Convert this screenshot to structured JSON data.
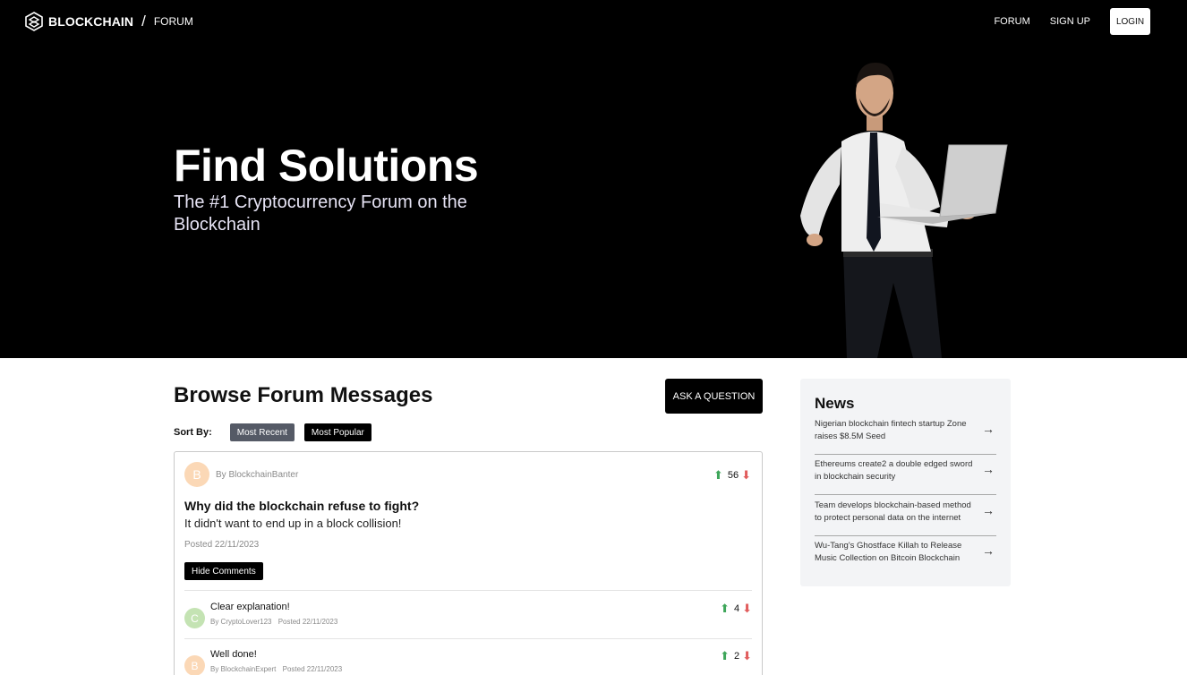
{
  "nav": {
    "brand": "BLOCKCHAIN",
    "separator": "/",
    "section": "FORUM",
    "links": {
      "forum": "FORUM",
      "signup": "SIGN UP",
      "login": "LOGIN"
    }
  },
  "hero": {
    "title": "Find Solutions",
    "subtitle": "The #1 Cryptocurrency Forum on the Blockchain"
  },
  "main": {
    "title": "Browse Forum Messages",
    "ask_button": "ASK A QUESTION",
    "sort_label": "Sort By:",
    "sort_recent": "Most Recent",
    "sort_popular": "Most Popular"
  },
  "post": {
    "avatar_letter": "B",
    "author": "By BlockchainBanter",
    "votes": "56",
    "title": "Why did the blockchain refuse to fight?",
    "body": "It didn't want to end up in a block collision!",
    "date": "Posted 22/11/2023",
    "hide_comments": "Hide Comments",
    "comments": [
      {
        "avatar_letter": "C",
        "text": "Clear explanation!",
        "author": "By CryptoLover123",
        "date": "Posted 22/11/2023",
        "votes": "4"
      },
      {
        "avatar_letter": "B",
        "text": "Well done!",
        "author": "By BlockchainExpert",
        "date": "Posted 22/11/2023",
        "votes": "2"
      }
    ]
  },
  "news": {
    "title": "News",
    "items": [
      "Nigerian blockchain fintech startup Zone raises $8.5M Seed",
      "Ethereums create2 a double edged sword in blockchain security",
      "Team develops blockchain-based method to protect personal data on the internet",
      "Wu-Tang's Ghostface Killah to Release Music Collection on Bitcoin Blockchain"
    ]
  },
  "icons": {
    "logo": "blockchain-logo-icon",
    "upvote": "arrow-up-icon",
    "downvote": "arrow-down-icon",
    "news_arrow": "arrow-right-icon"
  },
  "colors": {
    "hero_bg": "#000000",
    "upvote": "#3ea65a",
    "downvote": "#e15d5d",
    "sort_recent": "#555a66",
    "news_bg": "#f3f4f6"
  }
}
